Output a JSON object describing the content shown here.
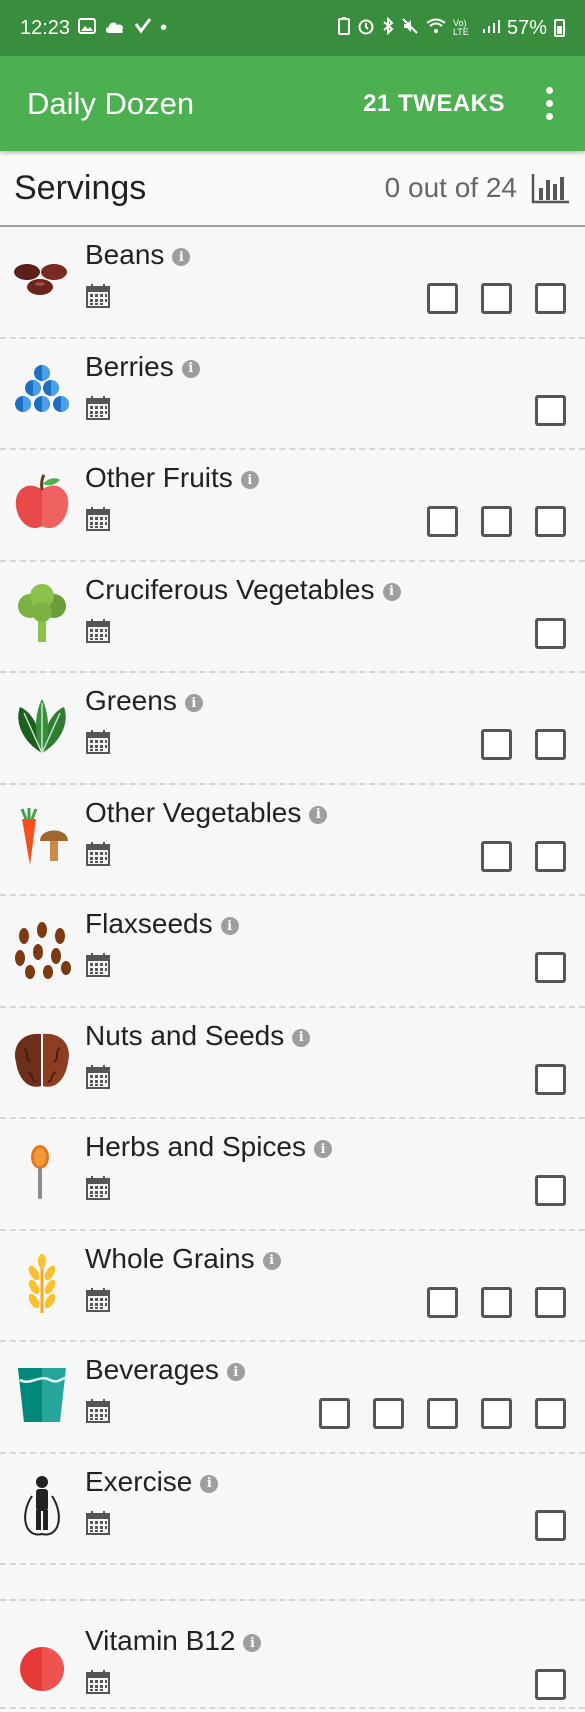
{
  "status": {
    "time": "12:23",
    "battery": "57%",
    "dot": "•",
    "lte": "Vo) LTE"
  },
  "app_bar": {
    "title": "Daily Dozen",
    "tweaks_label": "21 TWEAKS"
  },
  "servings": {
    "title": "Servings",
    "count_text": "0 out of 24"
  },
  "info_glyph": "i",
  "items": [
    {
      "name": "Beans",
      "icon": "beans-icon",
      "boxes": 3
    },
    {
      "name": "Berries",
      "icon": "berries-icon",
      "boxes": 1
    },
    {
      "name": "Other Fruits",
      "icon": "apple-icon",
      "boxes": 3
    },
    {
      "name": "Cruciferous Vegetables",
      "icon": "broccoli-icon",
      "boxes": 1
    },
    {
      "name": "Greens",
      "icon": "greens-icon",
      "boxes": 2
    },
    {
      "name": "Other Vegetables",
      "icon": "carrot-mushroom-icon",
      "boxes": 2
    },
    {
      "name": "Flaxseeds",
      "icon": "flaxseeds-icon",
      "boxes": 1
    },
    {
      "name": "Nuts and Seeds",
      "icon": "walnut-icon",
      "boxes": 1
    },
    {
      "name": "Herbs and Spices",
      "icon": "spoon-icon",
      "boxes": 1
    },
    {
      "name": "Whole Grains",
      "icon": "wheat-icon",
      "boxes": 3
    },
    {
      "name": "Beverages",
      "icon": "glass-icon",
      "boxes": 5
    },
    {
      "name": "Exercise",
      "icon": "jump-rope-icon",
      "boxes": 1
    }
  ],
  "supplement": {
    "name": "Vitamin B12",
    "icon": "pill-icon",
    "boxes": 1
  },
  "colors": {
    "status_bar": "#388e3c",
    "app_bar": "#4caf50"
  }
}
